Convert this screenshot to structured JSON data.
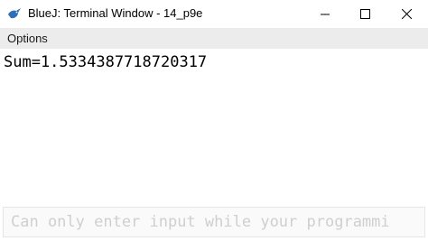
{
  "window": {
    "title": "BlueJ: Terminal Window - 14_p9e",
    "app_icon": "bluej-bird-icon"
  },
  "menubar": {
    "options_label": "Options"
  },
  "terminal": {
    "output_line": "Sum=1.5334387718720317",
    "input_placeholder": "Can only enter input while your programmi"
  },
  "colors": {
    "menubar_bg": "#ececec",
    "input_placeholder": "#cfcfcf"
  }
}
